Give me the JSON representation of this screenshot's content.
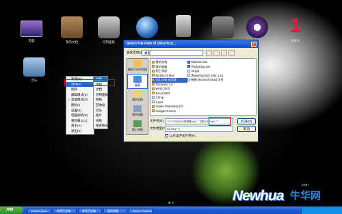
{
  "dock": [
    {
      "label": "电脑",
      "icon": "computer-icon"
    },
    {
      "label": "我的文档",
      "icon": "documents-icon"
    },
    {
      "label": "控制面板",
      "icon": "control-panel-icon"
    },
    {
      "label": "",
      "icon": "network-globe-icon"
    },
    {
      "label": "",
      "icon": "recycle-bin-icon"
    },
    {
      "label": "",
      "icon": "apps-folder-icon"
    },
    {
      "label": "",
      "icon": "user-icon"
    },
    {
      "label": "搜帐号",
      "glyph": "1",
      "icon": "number-one-icon"
    }
  ],
  "desktop_folder": {
    "label": "音乐",
    "icon": "music-folder-icon"
  },
  "context_menu": {
    "items": [
      "新建(W)",
      "添加(A)",
      "刷新",
      "编辑模式(E)",
      "桌面模式(D)",
      "图标(I)",
      "设置(S)",
      "电脑刷新(R)",
      "重新载入(L)",
      "关于(A)",
      "退出(X)"
    ],
    "selected_index": 1,
    "checked_index": 4,
    "submenu": {
      "items": [
        "文件",
        "电脑",
        "文档",
        "控制面板",
        "网络",
        "回收站",
        "音乐",
        "图片",
        "视频",
        "搜索按号"
      ],
      "selected_index": 0
    }
  },
  "dialog": {
    "title": "Select File Path of 1Shortcut...",
    "close_glyph": "×",
    "look_in_label": "查找范围(I):",
    "look_in_value": "桌面",
    "places": [
      "最近打开的文档",
      "桌面",
      "我的文档",
      "我的电脑",
      "网上邻居"
    ],
    "places_selected_index": 1,
    "files_col1": [
      "我的文档",
      "我的电脑",
      "网上邻居",
      "Mozilla Firefox",
      "QQ 2009 体验版",
      "TheWorld 3.0",
      "Word 2003",
      "Excel 2003",
      "3.bmp",
      "1.psd",
      "Adobe Photoshop CS",
      "Google Chrome"
    ],
    "files_col2": [
      "Maxthon.exe",
      "Photoshop.exe",
      "oo.jpg",
      "ffweiqiVip2010_SIB_1.zip",
      "新建 Microsoft Word 文档.doc",
      "",
      "",
      "",
      "",
      "",
      "",
      ""
    ],
    "files_col3": [
      "",
      "",
      "",
      "",
      "",
      "",
      "",
      "",
      "",
      "",
      "",
      ""
    ],
    "selected_file_index": 4,
    "filename_label": "文件名(N):",
    "filename_value": "\"???? P2010 体验版.lnk\" \"飞信2010.lnk\" \"\"",
    "filetype_label": "文件类型(T):",
    "filetype_value": "All File(*.*)",
    "open_button": "打开(O)",
    "cancel_button": "取消",
    "readonly_label": "以只读方式打开(R)"
  },
  "taskbar": {
    "start_label": "开始",
    "tasks": [
      "Rocket Dock",
      "神奇百宝箱",
      "神奇百宝箱",
      "我的电脑",
      "Adobe Photoshop"
    ]
  },
  "watermark": {
    "brand": "Newhua",
    "chinese": "牛华网",
    "com": ".com"
  },
  "colors": {
    "accent": "#316ac5",
    "highlight_box": "#e00000",
    "taskbar": "#1f5ad8",
    "dock_number": "#e21b3a"
  }
}
